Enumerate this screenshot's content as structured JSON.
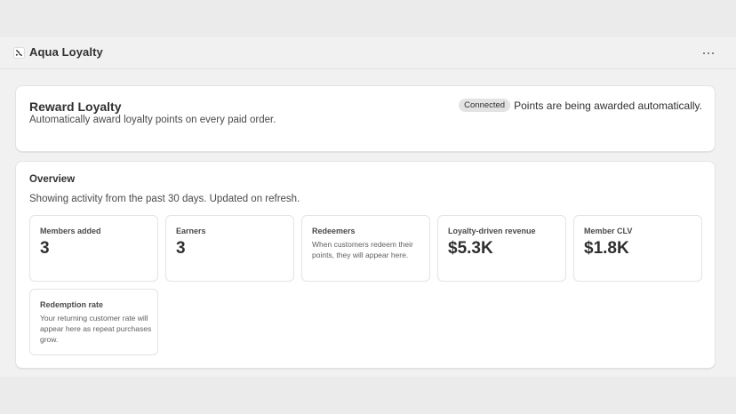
{
  "app": {
    "title": "Aqua Loyalty",
    "logo_icon": "aqua-loyalty-logo-icon",
    "more_icon": "more-horizontal-icon"
  },
  "reward": {
    "title": "Reward Loyalty",
    "description": "Automatically award loyalty points on every paid order.",
    "badge": "Connected",
    "status_text": "Points are being awarded automatically."
  },
  "overview": {
    "title": "Overview",
    "subtitle": "Showing activity from the past 30 days. Updated on refresh.",
    "metrics": [
      {
        "label": "Members added",
        "value": "3"
      },
      {
        "label": "Earners",
        "value": "3"
      },
      {
        "label": "Redeemers",
        "description": "When customers redeem their points, they will appear here."
      },
      {
        "label": "Loyalty-driven revenue",
        "value": "$5.3K"
      },
      {
        "label": "Member CLV",
        "value": "$1.8K"
      },
      {
        "label": "Redemption rate",
        "description": "Your returning customer rate will appear here as repeat purchases grow."
      }
    ]
  },
  "colors": {
    "badge_bg": "#e3e3e3",
    "page_bg": "#f1f1f1",
    "card_bg": "#ffffff",
    "text": "#303030"
  }
}
